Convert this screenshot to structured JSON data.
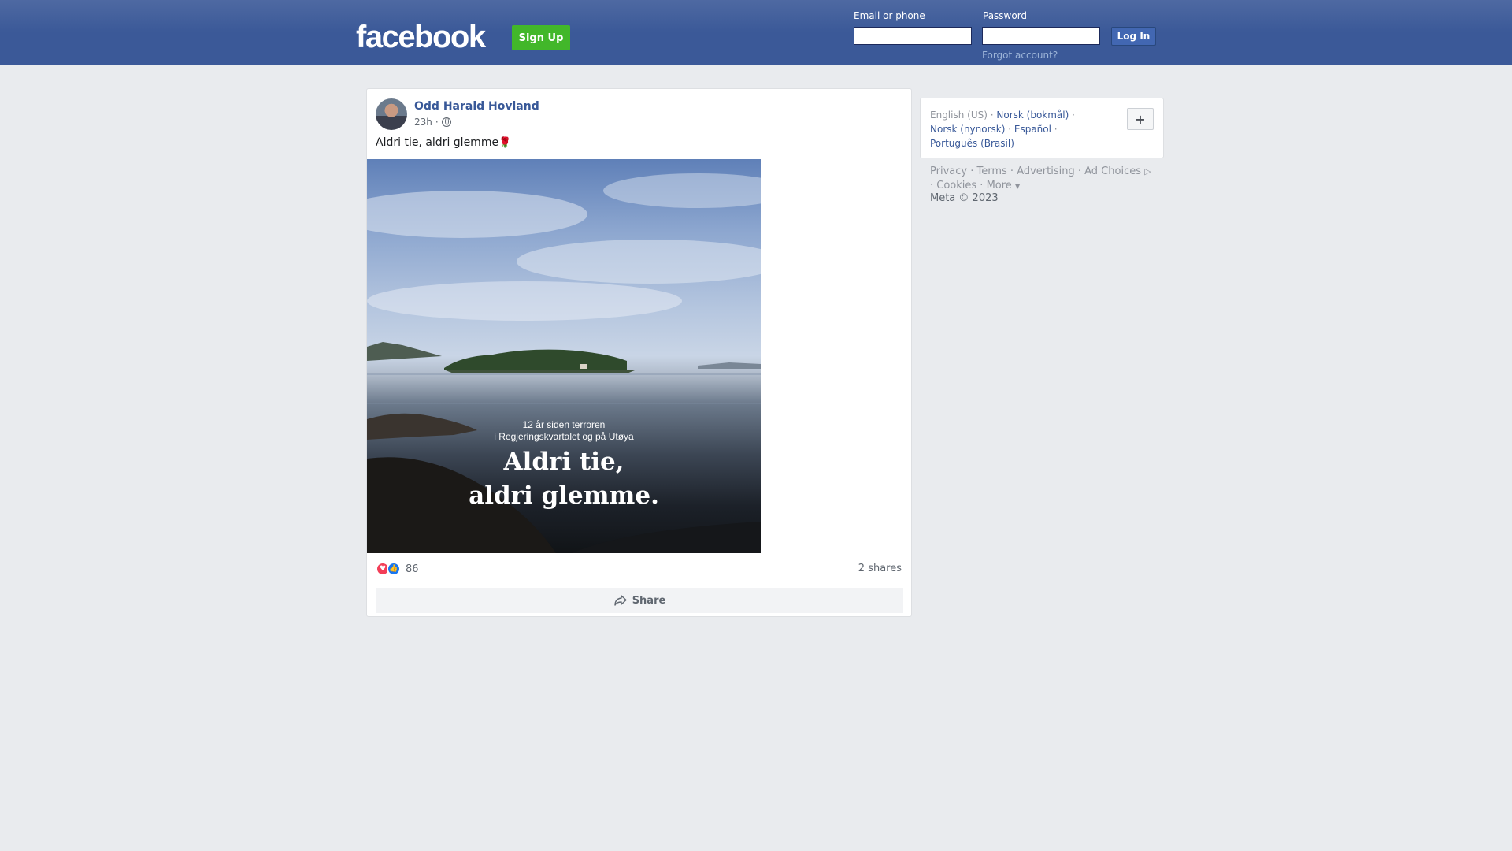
{
  "header": {
    "logo": "facebook",
    "signup_label": "Sign Up",
    "email_label": "Email or phone",
    "email_value": "",
    "password_label": "Password",
    "password_value": "",
    "login_label": "Log In",
    "forgot_label": "Forgot account?"
  },
  "post": {
    "author": "Odd Harald Hovland",
    "time": "23h",
    "separator": "·",
    "privacy_icon": "globe-icon",
    "text": "Aldri tie, aldri glemme",
    "text_emoji_icon": "rose-icon",
    "image": {
      "subtitle_line1": "12 år siden terroren",
      "subtitle_line2": "i Regjeringskvartalet og på Utøya",
      "title_line1": "Aldri tie,",
      "title_line2": "aldri glemme."
    },
    "reactions": {
      "icons": [
        "love-icon",
        "like-icon"
      ],
      "count": "86"
    },
    "shares": "2 shares",
    "share_label": "Share"
  },
  "languages": {
    "current": "English (US)",
    "items": [
      "Norsk (bokmål)",
      "Norsk (nynorsk)",
      "Español",
      "Português (Brasil)"
    ],
    "add_label": "+"
  },
  "footer": {
    "links": [
      "Privacy",
      "Terms",
      "Advertising",
      "Ad Choices",
      "Cookies",
      "More"
    ],
    "copyright": "Meta © 2023"
  },
  "colors": {
    "topbar": "#3b5998",
    "signup": "#42b72a",
    "link": "#385898",
    "background": "#e9ebee"
  }
}
